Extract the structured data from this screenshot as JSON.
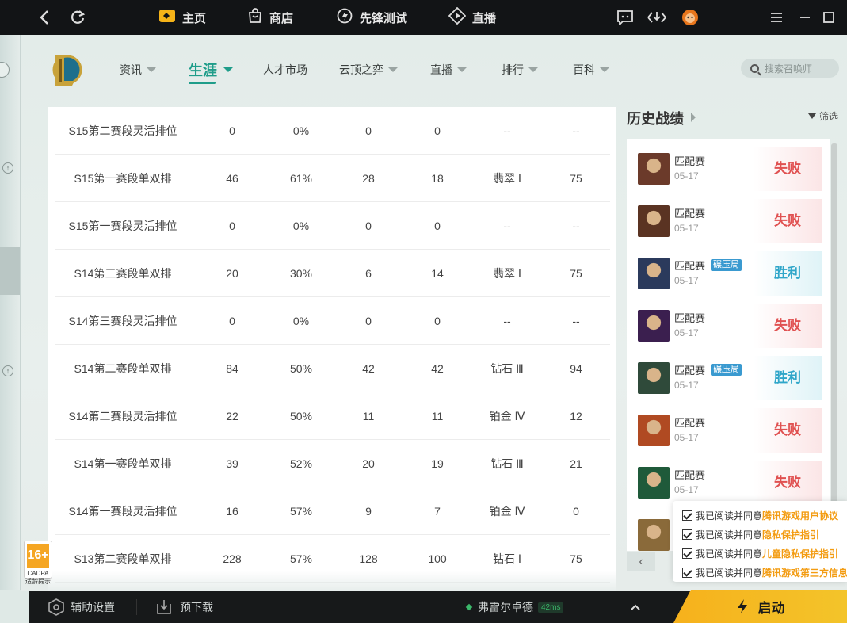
{
  "topbar": {
    "back_icon": "back-arrow-icon",
    "refresh_icon": "refresh-icon",
    "tabs": [
      {
        "label": "主页",
        "icon": "home-icon"
      },
      {
        "label": "商店",
        "icon": "shop-bag-icon"
      },
      {
        "label": "先锋测试",
        "icon": "lightning-icon"
      },
      {
        "label": "直播",
        "icon": "live-icon"
      }
    ],
    "right_icons": [
      "chat-icon",
      "download-icon",
      "avatar-icon"
    ],
    "menu_icon": "menu-icon",
    "minimize_icon": "minimize-icon",
    "maximize_icon": "maximize-icon"
  },
  "nav": {
    "items": [
      {
        "label": "资讯"
      },
      {
        "label": "生涯",
        "active": true
      },
      {
        "label": "人才市场"
      },
      {
        "label": "云顶之弈"
      },
      {
        "label": "直播"
      },
      {
        "label": "排行"
      },
      {
        "label": "百科"
      }
    ],
    "search_placeholder": "搜索召唤师"
  },
  "table": {
    "rows": [
      [
        "S15第二赛段灵活排位",
        "0",
        "0%",
        "0",
        "0",
        "--",
        "--"
      ],
      [
        "S15第一赛段单双排",
        "46",
        "61%",
        "28",
        "18",
        "翡翠 Ⅰ",
        "75"
      ],
      [
        "S15第一赛段灵活排位",
        "0",
        "0%",
        "0",
        "0",
        "--",
        "--"
      ],
      [
        "S14第三赛段单双排",
        "20",
        "30%",
        "6",
        "14",
        "翡翠 Ⅰ",
        "75"
      ],
      [
        "S14第三赛段灵活排位",
        "0",
        "0%",
        "0",
        "0",
        "--",
        "--"
      ],
      [
        "S14第二赛段单双排",
        "84",
        "50%",
        "42",
        "42",
        "钻石 Ⅲ",
        "94"
      ],
      [
        "S14第二赛段灵活排位",
        "22",
        "50%",
        "11",
        "11",
        "铂金 Ⅳ",
        "12"
      ],
      [
        "S14第一赛段单双排",
        "39",
        "52%",
        "20",
        "19",
        "钻石 Ⅲ",
        "21"
      ],
      [
        "S14第一赛段灵活排位",
        "16",
        "57%",
        "9",
        "7",
        "铂金 Ⅳ",
        "0"
      ],
      [
        "S13第二赛段单双排",
        "228",
        "57%",
        "128",
        "100",
        "钻石 Ⅰ",
        "75"
      ]
    ]
  },
  "history": {
    "title": "历史战绩",
    "filter_label": "筛选",
    "matches": [
      {
        "mode": "匹配赛",
        "date": "05-17",
        "result": "失败",
        "win": false,
        "tag": ""
      },
      {
        "mode": "匹配赛",
        "date": "05-17",
        "result": "失败",
        "win": false,
        "tag": ""
      },
      {
        "mode": "匹配赛",
        "date": "05-17",
        "result": "胜利",
        "win": true,
        "tag": "碾压局"
      },
      {
        "mode": "匹配赛",
        "date": "05-17",
        "result": "失败",
        "win": false,
        "tag": ""
      },
      {
        "mode": "匹配赛",
        "date": "05-17",
        "result": "胜利",
        "win": true,
        "tag": "碾压局"
      },
      {
        "mode": "匹配赛",
        "date": "05-17",
        "result": "失败",
        "win": false,
        "tag": ""
      },
      {
        "mode": "匹配赛",
        "date": "05-17",
        "result": "失败",
        "win": false,
        "tag": ""
      },
      {
        "mode": "",
        "date": "",
        "result": "",
        "win": false,
        "tag": ""
      }
    ],
    "avatar_colors": [
      "#6b3a2a",
      "#5a3322",
      "#2b3a5c",
      "#3b1f4f",
      "#2f4a3a",
      "#b04a22",
      "#1f5a3a",
      "#8a6a3a"
    ]
  },
  "agreements": [
    {
      "text": "我已阅读并同意",
      "link": "腾讯游戏用户协议"
    },
    {
      "text": "我已阅读并同意",
      "link": "隐私保护指引"
    },
    {
      "text": "我已阅读并同意",
      "link": "儿童隐私保护指引"
    },
    {
      "text": "我已阅读并同意",
      "link": "腾讯游戏第三方信息"
    }
  ],
  "age_badge": {
    "age": "16+",
    "line1": "CADPA",
    "line2": "适龄提示"
  },
  "bottom": {
    "assist_label": "辅助设置",
    "predownload_label": "预下载",
    "server": "弗雷尔卓德",
    "ping": "42ms",
    "launch_label": "启动"
  },
  "colors": {
    "accent": "#1f9d8a",
    "lose": "#e05151",
    "win": "#2fa6c9",
    "launch": "#f6b11c",
    "link": "#f39c12"
  }
}
